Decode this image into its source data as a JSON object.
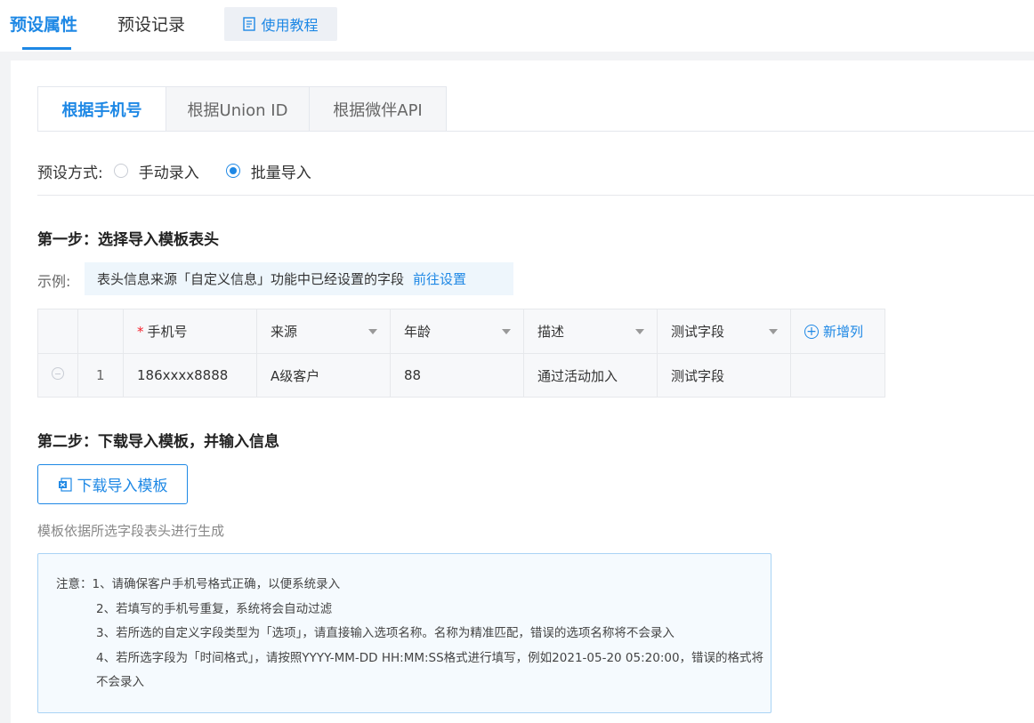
{
  "top_tabs": {
    "preset_attributes": "预设属性",
    "preset_records": "预设记录",
    "tutorial": "使用教程"
  },
  "sub_tabs": [
    "根据手机号",
    "根据Union ID",
    "根据微伴API"
  ],
  "preset_mode": {
    "label": "预设方式:",
    "options": [
      "手动录入",
      "批量导入"
    ],
    "selected": "批量导入"
  },
  "step1": {
    "title": "第一步：选择导入模板表头",
    "example_label": "示例:",
    "example_text": "表头信息来源「自定义信息」功能中已经设置的字段",
    "example_link": "前往设置"
  },
  "table": {
    "required_mark": "*",
    "headers": [
      "手机号",
      "来源",
      "年龄",
      "描述",
      "测试字段"
    ],
    "add_column": "新增列",
    "row": {
      "index": "1",
      "values": [
        "186xxxx8888",
        "A级客户",
        "88",
        "通过活动加入",
        "测试字段"
      ]
    }
  },
  "step2": {
    "title": "第二步：下载导入模板，并输入信息",
    "download_button": "下载导入模板",
    "hint": "模板依据所选字段表头进行生成"
  },
  "notice": {
    "prefix": "注意：",
    "items": [
      "1、请确保客户手机号格式正确，以便系统录入",
      "2、若填写的手机号重复，系统将会自动过滤",
      "3、若所选的自定义字段类型为「选项」，请直接输入选项名称。名称为精准匹配，错误的选项名称将不会录入",
      "4、若所选字段为「时间格式」，请按照YYYY-MM-DD HH:MM:SS格式进行填写，例如2021-05-20 05:20:00，错误的格式将不会录入"
    ]
  },
  "colors": {
    "accent": "#1e88e5",
    "required": "#f5222d"
  }
}
